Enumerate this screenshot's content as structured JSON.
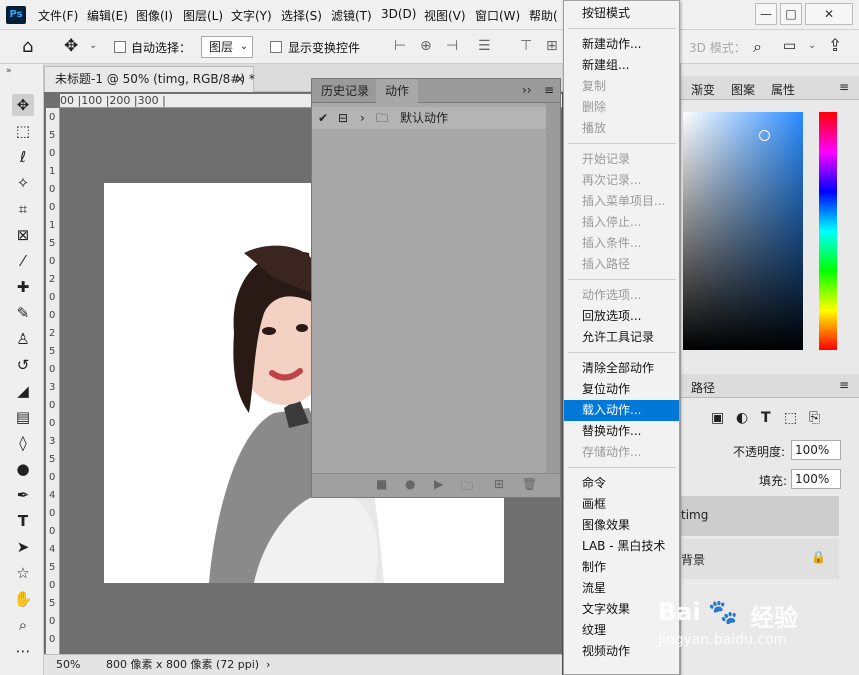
{
  "menubar": {
    "logo": "Ps",
    "items": [
      "文件(F)",
      "编辑(E)",
      "图像(I)",
      "图层(L)",
      "文字(Y)",
      "选择(S)",
      "滤镜(T)",
      "3D(D)",
      "视图(V)",
      "窗口(W)",
      "帮助("
    ]
  },
  "options": {
    "auto_select_label": "自动选择：",
    "layer_select": "图层",
    "show_transform_label": "显示变换控件",
    "mode_3d": "3D 模式："
  },
  "document": {
    "tab_title": "未标题-1 @ 50% (timg, RGB/8#) *",
    "close": "×",
    "ruler_top": "00    |100       |200       |300       |",
    "ruler_left": [
      "0",
      "5",
      "0",
      "1",
      "0",
      "0",
      "1",
      "5",
      "0",
      "2",
      "0",
      "0",
      "2",
      "5",
      "0",
      "3",
      "0",
      "0",
      "3",
      "5",
      "0",
      "4",
      "0",
      "0",
      "4",
      "5",
      "0",
      "5",
      "0",
      "0"
    ],
    "zoom": "50%",
    "size_info": "800 像素 x 800 像素 (72 ppi)",
    "status_arrow": "›"
  },
  "actions_panel": {
    "tabs": [
      "历史记录",
      "动作"
    ],
    "active_tab": "动作",
    "tab_more": "››",
    "menu_icon": "≡",
    "rows": [
      {
        "check": "✔",
        "toggle": "⊟",
        "expand": "›",
        "label": "默认动作"
      }
    ],
    "bottom_icons": [
      "■",
      "●",
      "▶",
      "🗀",
      "⊞",
      "🗑"
    ]
  },
  "context_menu": {
    "items": [
      {
        "label": "按钮模式",
        "enabled": true
      },
      {
        "sep": true
      },
      {
        "label": "新建动作...",
        "enabled": true
      },
      {
        "label": "新建组...",
        "enabled": true
      },
      {
        "label": "复制",
        "enabled": false
      },
      {
        "label": "删除",
        "enabled": false
      },
      {
        "label": "播放",
        "enabled": false
      },
      {
        "sep": true
      },
      {
        "label": "开始记录",
        "enabled": false
      },
      {
        "label": "再次记录...",
        "enabled": false
      },
      {
        "label": "插入菜单项目...",
        "enabled": false
      },
      {
        "label": "插入停止...",
        "enabled": false
      },
      {
        "label": "插入条件...",
        "enabled": false
      },
      {
        "label": "插入路径",
        "enabled": false
      },
      {
        "sep": true
      },
      {
        "label": "动作选项...",
        "enabled": false
      },
      {
        "label": "回放选项...",
        "enabled": true
      },
      {
        "label": "允许工具记录",
        "enabled": true
      },
      {
        "sep": true
      },
      {
        "label": "清除全部动作",
        "enabled": true
      },
      {
        "label": "复位动作",
        "enabled": true
      },
      {
        "label": "载入动作...",
        "enabled": true,
        "highlighted": true
      },
      {
        "label": "替换动作...",
        "enabled": true
      },
      {
        "label": "存储动作...",
        "enabled": false
      },
      {
        "sep": true
      },
      {
        "label": "命令",
        "enabled": true
      },
      {
        "label": "画框",
        "enabled": true
      },
      {
        "label": "图像效果",
        "enabled": true
      },
      {
        "label": "LAB - 黑白技术",
        "enabled": true
      },
      {
        "label": "制作",
        "enabled": true
      },
      {
        "label": "流星",
        "enabled": true
      },
      {
        "label": "文字效果",
        "enabled": true
      },
      {
        "label": "纹理",
        "enabled": true
      },
      {
        "label": "视频动作",
        "enabled": true
      }
    ]
  },
  "right_panels": {
    "color_tabs": [
      "渐变",
      "图案",
      "属性"
    ],
    "layers_tab": "路径",
    "opacity_label": "不透明度:",
    "opacity_value": "100%",
    "fill_label": "填充:",
    "fill_value": "100%",
    "layer_timg": "timg",
    "layer_bg": "背景"
  },
  "watermark": {
    "brand": "Bai",
    "brand_cn": "经验",
    "url": "jingyan.baidu.com"
  },
  "colors": {
    "menu_highlight": "#0078d7",
    "ps_logo_bg": "#001e36",
    "ps_logo_fg": "#31a8ff"
  }
}
